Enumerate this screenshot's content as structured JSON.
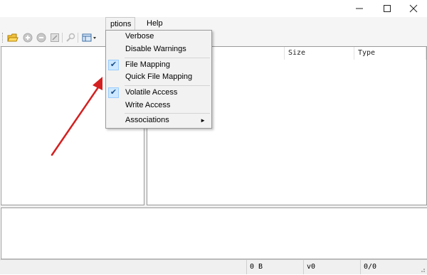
{
  "menubar": {
    "options_label": "ptions",
    "help_label": "Help"
  },
  "window_controls": {
    "minimize": "—",
    "maximize": "☐",
    "close": "✕"
  },
  "list": {
    "columns": [
      {
        "label": ""
      },
      {
        "label": "Size"
      },
      {
        "label": "Type"
      }
    ]
  },
  "options_menu": {
    "items": [
      {
        "label": "Verbose",
        "checked": false
      },
      {
        "label": "Disable Warnings",
        "checked": false
      },
      {
        "label": "File Mapping",
        "checked": true
      },
      {
        "label": "Quick File Mapping",
        "checked": false
      },
      {
        "label": "Volatile Access",
        "checked": true
      },
      {
        "label": "Write Access",
        "checked": false
      },
      {
        "label": "Associations",
        "checked": false,
        "submenu_arrow": "►"
      }
    ],
    "check_glyph": "✔"
  },
  "statusbar": {
    "size": "0 B",
    "version": "v0",
    "count": "0/0"
  },
  "colors": {
    "arrow": "#d42020",
    "check_bg": "#cde8ff",
    "menu_bg": "#f2f2f2"
  }
}
